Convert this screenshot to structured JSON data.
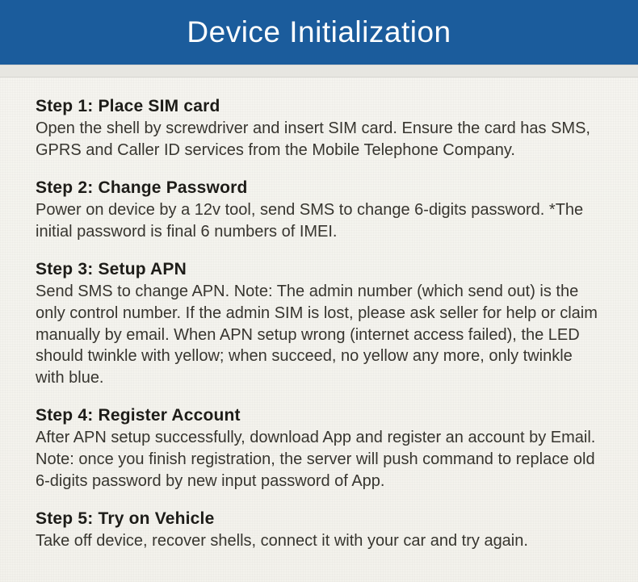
{
  "header": {
    "title": "Device Initialization"
  },
  "steps": [
    {
      "title": "Step 1: Place SIM card",
      "body": "Open the shell by screwdriver and insert SIM card. Ensure the card has SMS, GPRS and Caller ID services from the Mobile Telephone Company."
    },
    {
      "title": "Step 2: Change Password",
      "body": "Power on device by a 12v tool, send SMS to change 6-digits password. *The initial password is final 6 numbers of IMEI."
    },
    {
      "title": "Step 3: Setup APN",
      "body": "Send SMS to change APN. Note: The admin number (which send out) is the only control number. If the admin SIM is lost, please ask seller for help or claim manually by email.\nWhen APN setup wrong (internet access failed), the LED should twinkle with yellow; when succeed, no yellow any more, only twinkle with blue."
    },
    {
      "title": "Step 4: Register Account",
      "body": "After APN setup successfully, download App and register an account by Email. Note: once you finish registration, the server will push command to replace old 6-digits password by new input password of App."
    },
    {
      "title": "Step 5: Try on Vehicle",
      "body": "Take off device, recover shells, connect it with your car and try again."
    }
  ]
}
